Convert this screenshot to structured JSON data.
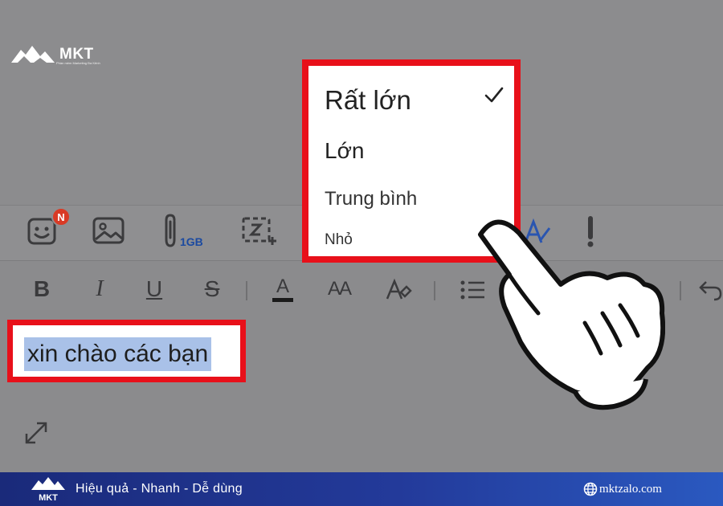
{
  "brand": {
    "logo_text": "MKT",
    "logo_tagline": "Phần mềm Marketing Đa Kênh"
  },
  "toolbar": {
    "notification_badge": "N",
    "attachment_size_label": "1GB"
  },
  "format_bar": {
    "bold": "B",
    "italic": "I",
    "underline": "U",
    "strikethrough": "S",
    "font_color": "A",
    "font_size": "AA"
  },
  "editor": {
    "selected_text": "xin chào các bạn"
  },
  "font_size_menu": {
    "items": [
      {
        "label": "Rất lớn",
        "checked": true
      },
      {
        "label": "Lớn",
        "checked": false
      },
      {
        "label": "Trung bình",
        "checked": false
      },
      {
        "label": "Nhỏ",
        "checked": false
      }
    ],
    "check_mark": "✓"
  },
  "footer": {
    "slogan": "Hiệu quả - Nhanh - Dễ dùng",
    "website": "mktzalo.com"
  },
  "colors": {
    "highlight_red": "#e8101a",
    "selection_blue": "#a9c1e8",
    "footer_blue": "#233a9a"
  }
}
